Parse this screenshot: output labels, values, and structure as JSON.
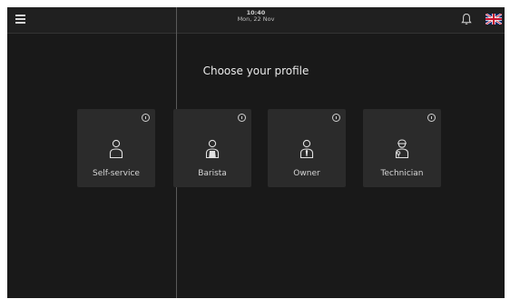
{
  "header": {
    "time": "10:40",
    "date": "Mon, 22 Nov"
  },
  "icons": {
    "menu": "menu-icon",
    "bell": "bell-icon",
    "language": "uk-flag-icon",
    "info": "info-icon"
  },
  "main": {
    "title": "Choose your profile",
    "profiles": [
      {
        "label": "Self-service",
        "icon": "person-icon"
      },
      {
        "label": "Barista",
        "icon": "barista-icon"
      },
      {
        "label": "Owner",
        "icon": "owner-icon"
      },
      {
        "label": "Technician",
        "icon": "technician-icon"
      }
    ]
  },
  "colors": {
    "background": "#191919",
    "card": "#2b2b2b",
    "text": "#eaeaea"
  }
}
